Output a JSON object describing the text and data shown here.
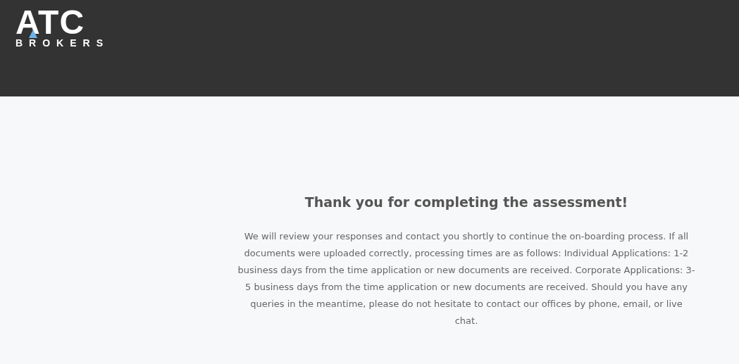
{
  "header": {
    "logo": {
      "wordmark": "ATC",
      "tagline": "BROKERS"
    }
  },
  "message": {
    "title": "Thank you for completing the assessment!",
    "body": "We will review your responses and contact you shortly to continue the on-boarding process. If all documents were uploaded correctly, processing times are as follows: Individual Applications: 1-2 business days from the time application or new documents are received. Corporate Applications: 3-5 business days from the time application or new documents are received. Should you have any queries in the meantime, please do not hesitate to contact our offices by phone, email, or live chat."
  }
}
